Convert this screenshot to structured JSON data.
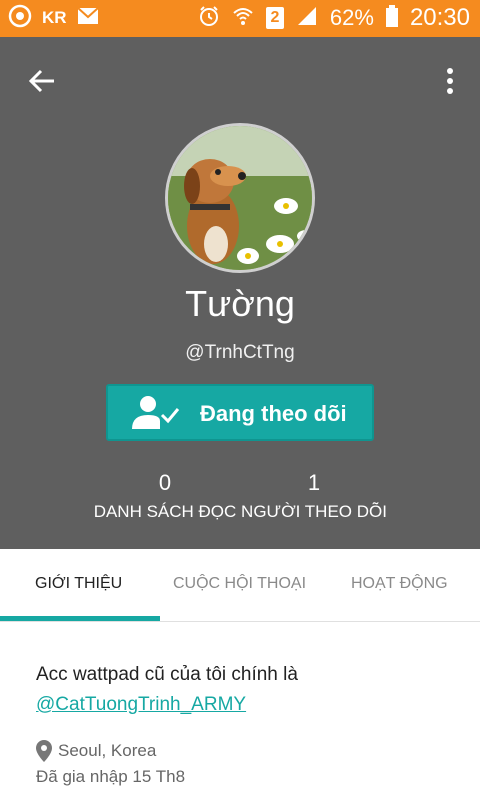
{
  "status_bar": {
    "carrier": "KR",
    "battery_percent": "62%",
    "time": "20:30",
    "sim_slot": "2",
    "icons": [
      "record-icon",
      "mail-icon",
      "alarm-icon",
      "wifi-icon",
      "sim-icon",
      "signal-icon",
      "battery-icon"
    ]
  },
  "profile": {
    "name": "Tường",
    "handle": "@TrnhCtTng",
    "follow_button_label": "Đang theo dõi",
    "stats": [
      {
        "value": "0",
        "label": "DANH SÁCH ĐỌC"
      },
      {
        "value": "1",
        "label": "NGƯỜI THEO DÕI"
      }
    ]
  },
  "tabs": [
    {
      "label": "GIỚI THIỆU",
      "active": true
    },
    {
      "label": "CUỘC HỘI THOẠI",
      "active": false
    },
    {
      "label": "HOẠT ĐỘNG",
      "active": false
    }
  ],
  "about": {
    "text": "Acc wattpad cũ của tôi chính là",
    "link": "@CatTuongTrinh_ARMY",
    "location": "Seoul, Korea",
    "joined": "Đã gia nhập 15 Th8"
  },
  "colors": {
    "status_bar": "#f58b1f",
    "header": "#5f5f5f",
    "accent": "#16a8a3"
  }
}
